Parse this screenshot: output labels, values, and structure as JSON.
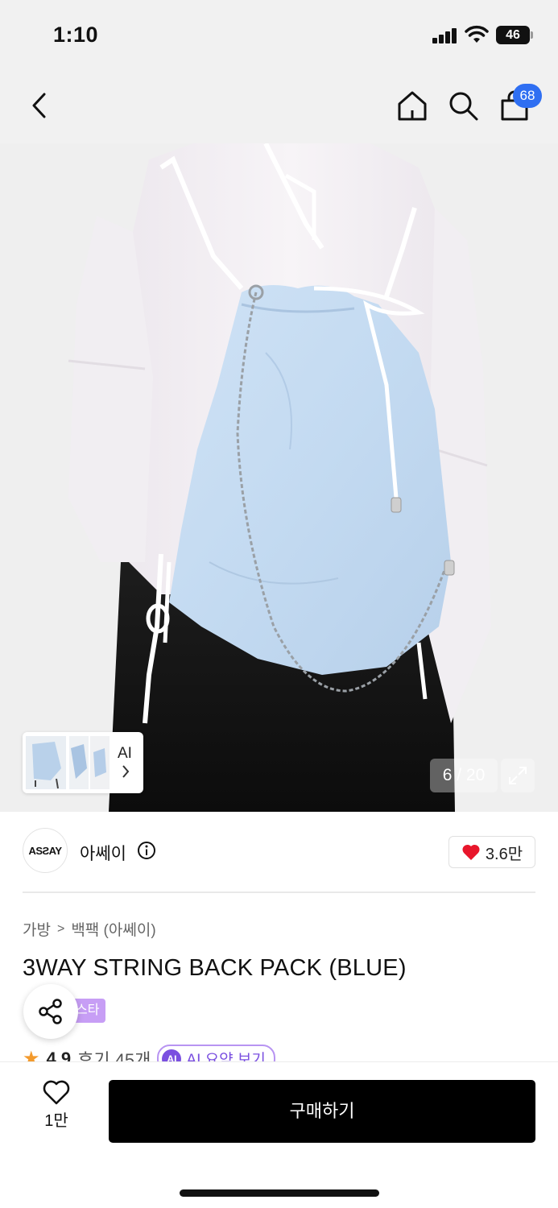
{
  "status_bar": {
    "time": "1:10",
    "battery": "46"
  },
  "nav": {
    "back_icon": "chevron-left-icon",
    "home_icon": "home-icon",
    "search_icon": "search-icon",
    "cart_icon": "shopping-bag-icon",
    "cart_count": "68"
  },
  "gallery": {
    "thumbnail_label": "AI",
    "counter": "6 / 20",
    "current_index": 6,
    "total": 20,
    "expand_icon": "expand-icon"
  },
  "brand": {
    "logo_text": "ASƧAY",
    "name": "아쎄이",
    "like_count": "3.6만"
  },
  "product": {
    "breadcrumb_category": "가방",
    "breadcrumb_separator": ">",
    "breadcrumb_subcategory": "백팩 (아쎄이)",
    "title": "3WAY STRING BACK PACK (BLUE)",
    "tag_badge": "스타",
    "rating": "4.9",
    "review_count": "후기 45개",
    "ai_summary_label": "AI 요약 보기",
    "ai_badge": "AI"
  },
  "bottom_bar": {
    "wish_count": "1만",
    "buy_label": "구매하기"
  },
  "colors": {
    "accent_blue": "#2f6ff2",
    "heart_red": "#e8162b",
    "ai_purple": "#7a4fe0",
    "tag_purple": "#c79ef5",
    "buy_black": "#000000"
  }
}
